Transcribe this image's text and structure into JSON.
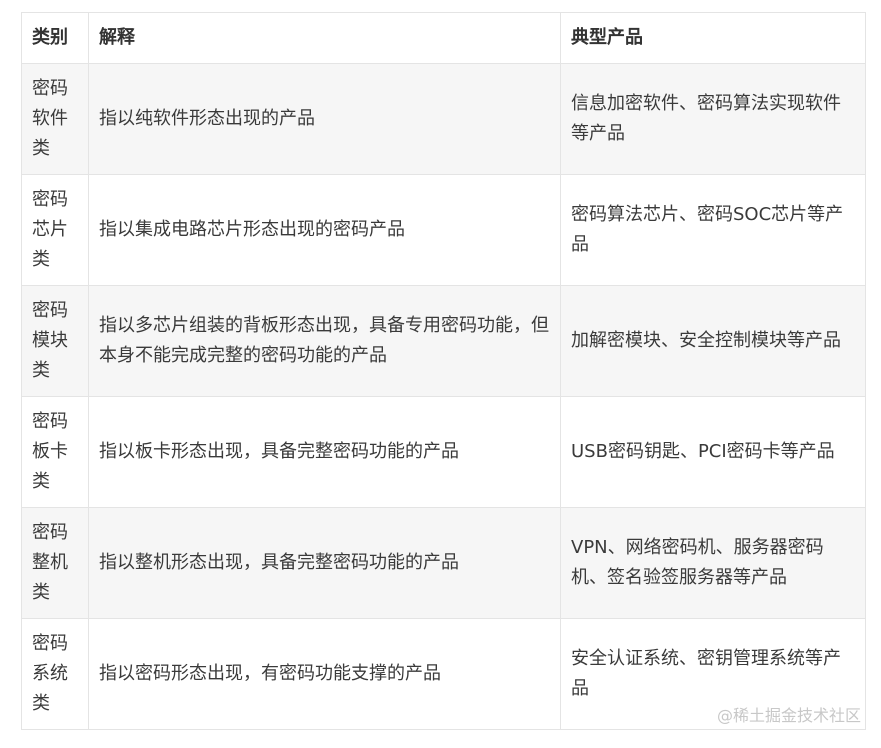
{
  "table": {
    "headers": [
      "类别",
      "解释",
      "典型产品"
    ],
    "rows": [
      {
        "category": "密码软件类",
        "explanation": "指以纯软件形态出现的产品",
        "products": "信息加密软件、密码算法实现软件等产品"
      },
      {
        "category": "密码芯片类",
        "explanation": "指以集成电路芯片形态出现的密码产品",
        "products": "密码算法芯片、密码SOC芯片等产品"
      },
      {
        "category": "密码模块类",
        "explanation": "指以多芯片组装的背板形态出现，具备专用密码功能，但本身不能完成完整的密码功能的产品",
        "products": "加解密模块、安全控制模块等产品"
      },
      {
        "category": "密码板卡类",
        "explanation": "指以板卡形态出现，具备完整密码功能的产品",
        "products": "USB密码钥匙、PCI密码卡等产品"
      },
      {
        "category": "密码整机类",
        "explanation": "指以整机形态出现，具备完整密码功能的产品",
        "products": "VPN、网络密码机、服务器密码机、签名验签服务器等产品"
      },
      {
        "category": "密码系统类",
        "explanation": "指以密码形态出现，有密码功能支撑的产品",
        "products": "安全认证系统、密钥管理系统等产品"
      }
    ]
  },
  "watermark": "@稀土掘金技术社区"
}
